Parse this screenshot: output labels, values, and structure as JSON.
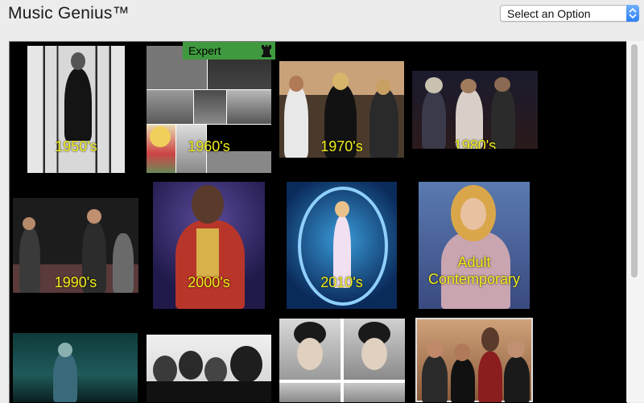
{
  "app": {
    "title": "Music Genius™"
  },
  "option_select": {
    "selected": "Select an Option"
  },
  "badge": {
    "label": "Expert",
    "icon": "rook-icon"
  },
  "categories": [
    {
      "label": "1950's"
    },
    {
      "label": "1960's"
    },
    {
      "label": "1970's"
    },
    {
      "label": "1980's"
    },
    {
      "label": "1990's"
    },
    {
      "label": "2000's"
    },
    {
      "label": "2010's"
    },
    {
      "label": "Adult Contemporary"
    },
    {
      "label": ""
    },
    {
      "label": ""
    },
    {
      "label": ""
    },
    {
      "label": ""
    }
  ],
  "colors": {
    "label_yellow": "#f2ee1a",
    "badge_green": "#3f9a3f",
    "select_arrow_blue": "#2f7ff5"
  }
}
